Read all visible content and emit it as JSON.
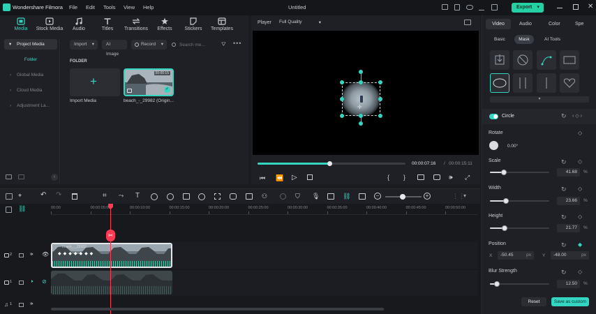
{
  "app": {
    "name": "Wondershare Filmora",
    "menu": [
      "File",
      "Edit",
      "Tools",
      "View",
      "Help"
    ],
    "doc_title": "Untitled",
    "export_label": "Export"
  },
  "modules": [
    "Media",
    "Stock Media",
    "Audio",
    "Titles",
    "Transitions",
    "Effects",
    "Stickers",
    "Templates"
  ],
  "sidebar": {
    "project_media": "Project Media",
    "folder": "Folder",
    "items": [
      "Global Media",
      "Cloud Media",
      "Adjustment La..."
    ]
  },
  "media_toolbar": {
    "import": "Import",
    "ai_image": "AI Image",
    "record": "Record",
    "search_placeholder": "Search me..."
  },
  "media": {
    "folder_label": "FOLDER",
    "import_label": "Import Media",
    "clip_name": "beach_-_29982 (Origin...",
    "clip_duration": "00:00:15"
  },
  "player": {
    "label": "Player",
    "quality": "Full Quality",
    "current_time": "00:00:07:16",
    "separator": "/",
    "total_time": "00:00:15:11",
    "progress": 0.49
  },
  "props": {
    "tabs": [
      "Video",
      "Audio",
      "Color",
      "Spe"
    ],
    "subtabs": [
      "Basic",
      "Mask",
      "AI Tools"
    ],
    "mask_name": "Circle",
    "rotate_label": "Rotate",
    "rotate_value": "0.00°",
    "scale_label": "Scale",
    "scale_value": "41.68",
    "scale_level": 0.23,
    "width_label": "Width",
    "width_value": "23.66",
    "width_level": 0.27,
    "height_label": "Height",
    "height_value": "21.77",
    "height_level": 0.25,
    "position_label": "Position",
    "pos_x_label": "X",
    "pos_x": "-50.45",
    "pos_y_label": "Y",
    "pos_y": "-48.00",
    "px": "px",
    "percent": "%",
    "blur_label": "Blur Strength",
    "blur_value": "12.50",
    "blur_level": 0.12,
    "reset": "Reset",
    "save_custom": "Save as custom"
  },
  "timeline": {
    "ruler": [
      "00:00",
      "00:00:05:00",
      "00:00:10:00",
      "00:00:15:00",
      "00:00:20:00",
      "00:00:25:00",
      "00:00:30:00",
      "00:00:35:00",
      "00:00:40:00",
      "00:00:45:00",
      "00:00:50:00"
    ],
    "track_labels": [
      "2",
      "1",
      "1"
    ],
    "clip_label": "beach_-_29982"
  },
  "colors": {
    "accent": "#35d6c1",
    "playhead": "#ff3a52",
    "export": "#24d1a4"
  }
}
